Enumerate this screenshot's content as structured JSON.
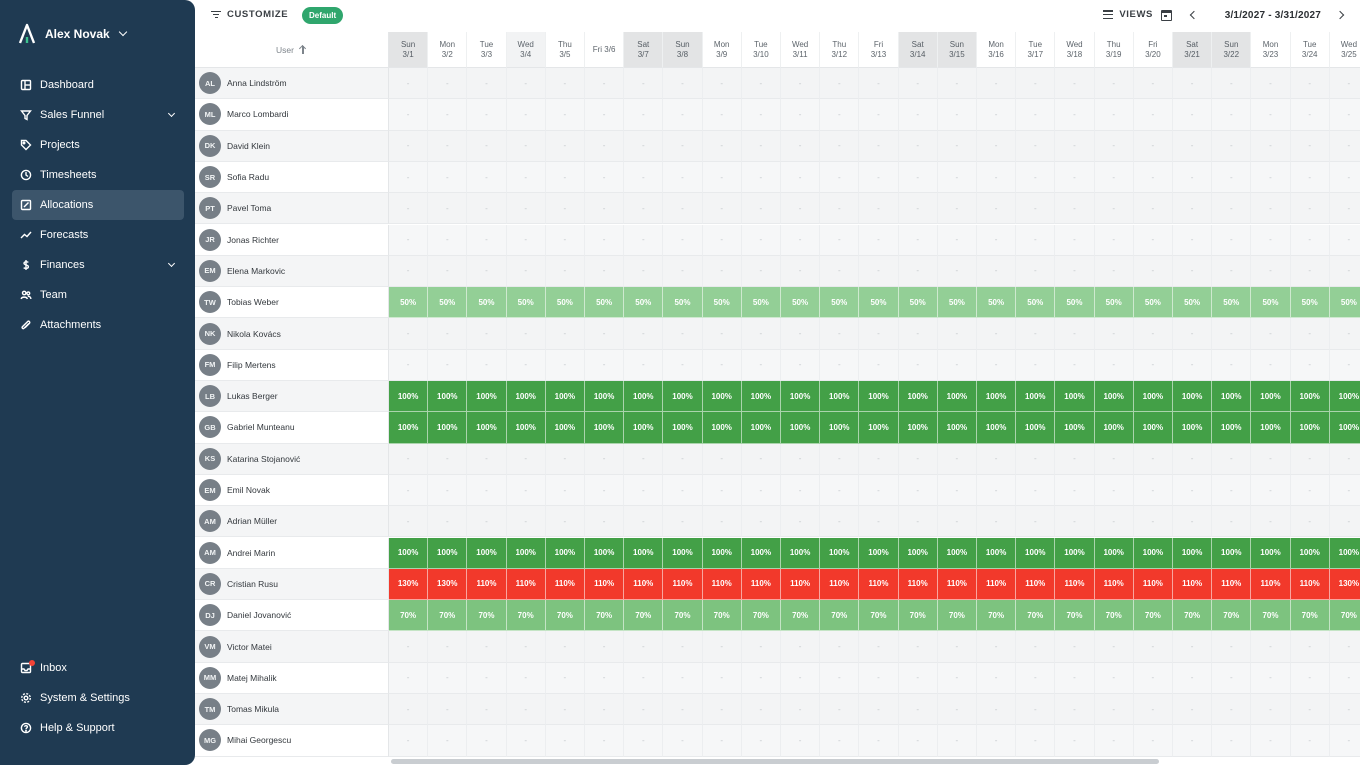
{
  "sidebar": {
    "user_name": "Alex Novak",
    "nav_top": [
      {
        "label": "Dashboard",
        "icon": "dashboard-icon",
        "key": "dashboard",
        "expand": false,
        "active": false
      },
      {
        "label": "Sales Funnel",
        "icon": "funnel-icon",
        "key": "sales-funnel",
        "expand": true,
        "active": false
      },
      {
        "label": "Projects",
        "icon": "tag-icon",
        "key": "projects",
        "expand": false,
        "active": false
      },
      {
        "label": "Timesheets",
        "icon": "clock-icon",
        "key": "timesheets",
        "expand": false,
        "active": false
      },
      {
        "label": "Allocations",
        "icon": "edit-icon",
        "key": "allocations",
        "expand": false,
        "active": true
      },
      {
        "label": "Forecasts",
        "icon": "trend-icon",
        "key": "forecasts",
        "expand": false,
        "active": false
      },
      {
        "label": "Finances",
        "icon": "dollar-icon",
        "key": "finances",
        "expand": true,
        "active": false
      },
      {
        "label": "Team",
        "icon": "team-icon",
        "key": "team",
        "expand": false,
        "active": false
      },
      {
        "label": "Attachments",
        "icon": "paperclip-icon",
        "key": "attachments",
        "expand": false,
        "active": false
      }
    ],
    "nav_bottom": [
      {
        "label": "Inbox",
        "icon": "inbox-icon",
        "key": "inbox",
        "notify": true
      },
      {
        "label": "System & Settings",
        "icon": "gear-icon",
        "key": "settings",
        "notify": false
      },
      {
        "label": "Help & Support",
        "icon": "help-icon",
        "key": "help",
        "notify": false
      }
    ]
  },
  "toolbar": {
    "customize_label": "CUSTOMIZE",
    "badge_label": "Default",
    "views_label": "VIEWS",
    "date_range": "3/1/2027 - 3/31/2027"
  },
  "grid": {
    "user_header": "User",
    "days": [
      {
        "dow": "Sun",
        "date": "3/1",
        "type": "weekend"
      },
      {
        "dow": "Mon",
        "date": "3/2",
        "type": "weekday"
      },
      {
        "dow": "Tue",
        "date": "3/3",
        "type": "weekday"
      },
      {
        "dow": "Wed",
        "date": "3/4",
        "type": "dim"
      },
      {
        "dow": "Thu",
        "date": "3/5",
        "type": "weekday"
      },
      {
        "dow": "Fri 3/6",
        "date": "",
        "type": "weekday"
      },
      {
        "dow": "Sat",
        "date": "3/7",
        "type": "weekend"
      },
      {
        "dow": "Sun",
        "date": "3/8",
        "type": "weekend"
      },
      {
        "dow": "Mon",
        "date": "3/9",
        "type": "weekday"
      },
      {
        "dow": "Tue",
        "date": "3/10",
        "type": "weekday"
      },
      {
        "dow": "Wed",
        "date": "3/11",
        "type": "weekday"
      },
      {
        "dow": "Thu",
        "date": "3/12",
        "type": "weekday"
      },
      {
        "dow": "Fri",
        "date": "3/13",
        "type": "weekday"
      },
      {
        "dow": "Sat",
        "date": "3/14",
        "type": "weekend"
      },
      {
        "dow": "Sun",
        "date": "3/15",
        "type": "weekend"
      },
      {
        "dow": "Mon",
        "date": "3/16",
        "type": "weekday"
      },
      {
        "dow": "Tue",
        "date": "3/17",
        "type": "weekday"
      },
      {
        "dow": "Wed",
        "date": "3/18",
        "type": "weekday"
      },
      {
        "dow": "Thu",
        "date": "3/19",
        "type": "weekday"
      },
      {
        "dow": "Fri",
        "date": "3/20",
        "type": "weekday"
      },
      {
        "dow": "Sat",
        "date": "3/21",
        "type": "weekend"
      },
      {
        "dow": "Sun",
        "date": "3/22",
        "type": "weekend"
      },
      {
        "dow": "Mon",
        "date": "3/23",
        "type": "weekday"
      },
      {
        "dow": "Tue",
        "date": "3/24",
        "type": "weekday"
      },
      {
        "dow": "Wed",
        "date": "3/25",
        "type": "weekday"
      }
    ],
    "empty_mark": "-",
    "colors": {
      "50%": "#93cf96",
      "70%": "#7dc37f",
      "100%": "#43a047",
      "110%": "#f2392b",
      "130%": "#f2392b"
    },
    "users": [
      {
        "initials": "AL",
        "name": "Anna Lindström",
        "alloc": null
      },
      {
        "initials": "ML",
        "name": "Marco Lombardi",
        "alloc": null
      },
      {
        "initials": "DK",
        "name": "David Klein",
        "alloc": null
      },
      {
        "initials": "SR",
        "name": "Sofia Radu",
        "alloc": null
      },
      {
        "initials": "PT",
        "name": "Pavel Toma",
        "alloc": null
      },
      {
        "initials": "JR",
        "name": "Jonas Richter",
        "alloc": null
      },
      {
        "initials": "EM",
        "name": "Elena Markovic",
        "alloc": null
      },
      {
        "initials": "TW",
        "name": "Tobias Weber",
        "alloc": [
          "50%",
          "50%",
          "50%",
          "50%",
          "50%",
          "50%",
          "50%",
          "50%",
          "50%",
          "50%",
          "50%",
          "50%",
          "50%",
          "50%",
          "50%",
          "50%",
          "50%",
          "50%",
          "50%",
          "50%",
          "50%",
          "50%",
          "50%",
          "50%",
          "50%"
        ]
      },
      {
        "initials": "NK",
        "name": "Nikola Kovács",
        "alloc": null
      },
      {
        "initials": "FM",
        "name": "Filip Mertens",
        "alloc": null
      },
      {
        "initials": "LB",
        "name": "Lukas Berger",
        "alloc": [
          "100%",
          "100%",
          "100%",
          "100%",
          "100%",
          "100%",
          "100%",
          "100%",
          "100%",
          "100%",
          "100%",
          "100%",
          "100%",
          "100%",
          "100%",
          "100%",
          "100%",
          "100%",
          "100%",
          "100%",
          "100%",
          "100%",
          "100%",
          "100%",
          "100%"
        ]
      },
      {
        "initials": "GB",
        "name": "Gabriel Munteanu",
        "alloc": [
          "100%",
          "100%",
          "100%",
          "100%",
          "100%",
          "100%",
          "100%",
          "100%",
          "100%",
          "100%",
          "100%",
          "100%",
          "100%",
          "100%",
          "100%",
          "100%",
          "100%",
          "100%",
          "100%",
          "100%",
          "100%",
          "100%",
          "100%",
          "100%",
          "100%"
        ]
      },
      {
        "initials": "KS",
        "name": "Katarina Stojanović",
        "alloc": null
      },
      {
        "initials": "EM",
        "name": "Emil Novak",
        "alloc": null
      },
      {
        "initials": "AM",
        "name": "Adrian Müller",
        "alloc": null
      },
      {
        "initials": "AM",
        "name": "Andrei Marin",
        "alloc": [
          "100%",
          "100%",
          "100%",
          "100%",
          "100%",
          "100%",
          "100%",
          "100%",
          "100%",
          "100%",
          "100%",
          "100%",
          "100%",
          "100%",
          "100%",
          "100%",
          "100%",
          "100%",
          "100%",
          "100%",
          "100%",
          "100%",
          "100%",
          "100%",
          "100%"
        ]
      },
      {
        "initials": "CR",
        "name": "Cristian Rusu",
        "alloc": [
          "130%",
          "130%",
          "110%",
          "110%",
          "110%",
          "110%",
          "110%",
          "110%",
          "110%",
          "110%",
          "110%",
          "110%",
          "110%",
          "110%",
          "110%",
          "110%",
          "110%",
          "110%",
          "110%",
          "110%",
          "110%",
          "110%",
          "110%",
          "110%",
          "130%"
        ]
      },
      {
        "initials": "DJ",
        "name": "Daniel Jovanović",
        "alloc": [
          "70%",
          "70%",
          "70%",
          "70%",
          "70%",
          "70%",
          "70%",
          "70%",
          "70%",
          "70%",
          "70%",
          "70%",
          "70%",
          "70%",
          "70%",
          "70%",
          "70%",
          "70%",
          "70%",
          "70%",
          "70%",
          "70%",
          "70%",
          "70%",
          "70%"
        ]
      },
      {
        "initials": "VM",
        "name": "Victor Matei",
        "alloc": null
      },
      {
        "initials": "MM",
        "name": "Matej Mihalik",
        "alloc": null
      },
      {
        "initials": "TM",
        "name": "Tomas Mikula",
        "alloc": null
      },
      {
        "initials": "MG",
        "name": "Mihai Georgescu",
        "alloc": null
      }
    ]
  }
}
